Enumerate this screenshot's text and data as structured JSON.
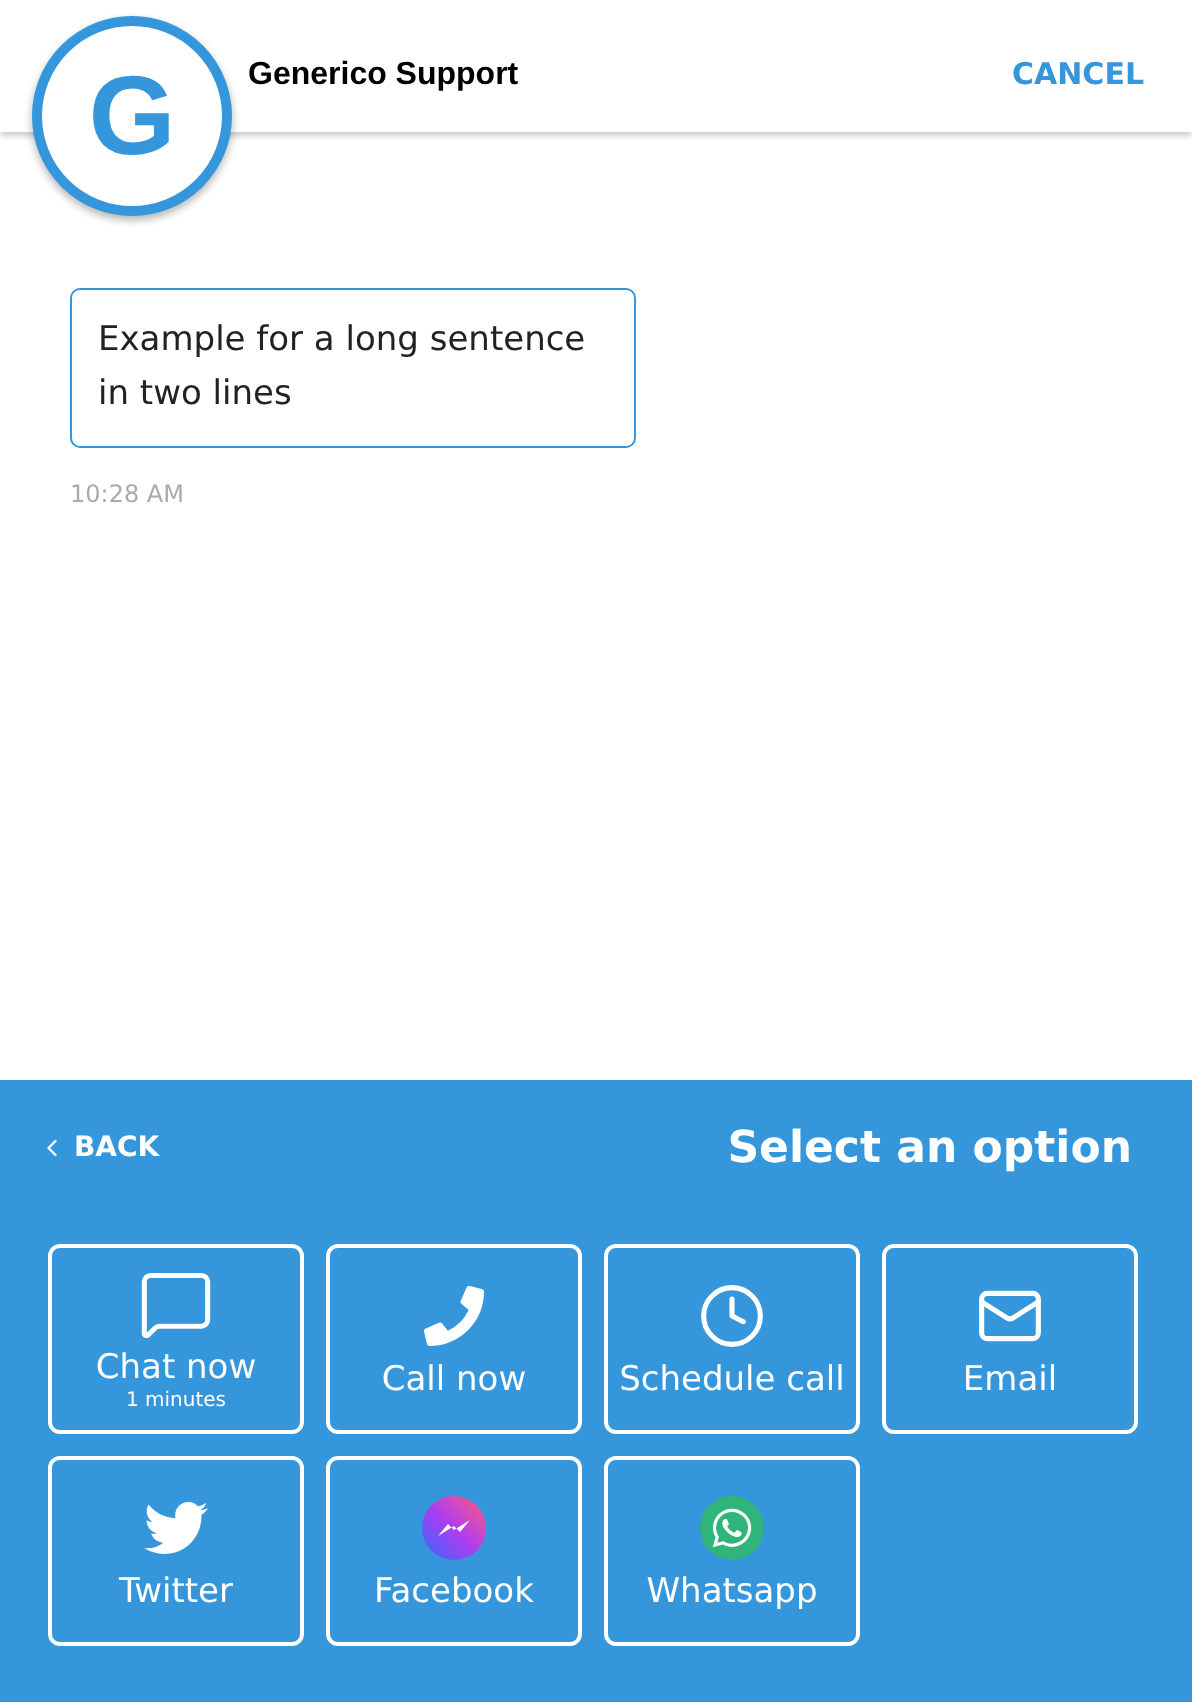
{
  "header": {
    "avatar_letter": "G",
    "title": "Generico Support",
    "cancel": "CANCEL"
  },
  "messages": [
    {
      "text": "Example for a long sentence in two lines",
      "time": "10:28 AM"
    }
  ],
  "panel": {
    "back": "BACK",
    "title": "Select an option",
    "options": [
      {
        "kind": "chat",
        "label": "Chat now",
        "sublabel": "1 minutes"
      },
      {
        "kind": "phone",
        "label": "Call now"
      },
      {
        "kind": "clock",
        "label": "Schedule call"
      },
      {
        "kind": "mail",
        "label": "Email"
      },
      {
        "kind": "twitter",
        "label": "Twitter"
      },
      {
        "kind": "messenger",
        "label": "Facebook"
      },
      {
        "kind": "whatsapp",
        "label": "Whatsapp"
      }
    ]
  }
}
